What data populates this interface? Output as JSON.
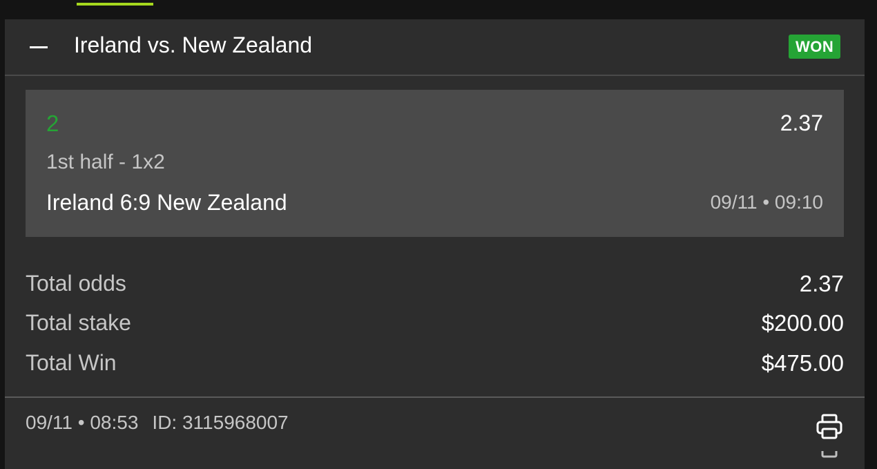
{
  "header": {
    "match_title": "Ireland vs. New Zealand",
    "status": "WON",
    "collapse_icon": "minus-icon"
  },
  "selection": {
    "pick": "2",
    "odds": "2.37",
    "market": "1st half - 1x2",
    "result": "Ireland 6:9 New Zealand",
    "datetime": "09/11 • 09:10"
  },
  "summary": {
    "total_odds_label": "Total odds",
    "total_odds_value": "2.37",
    "total_stake_label": "Total stake",
    "total_stake_value": "$200.00",
    "total_win_label": "Total Win",
    "total_win_value": "$475.00"
  },
  "footer": {
    "placed_datetime": "09/11 • 08:53",
    "bet_id": "ID: 3115968007",
    "print_icon": "printer-icon"
  },
  "colors": {
    "accent": "#a6d81e",
    "won": "#25a435",
    "card_bg": "#2d2d2d",
    "selection_bg": "#4a4a4a",
    "page_bg": "#141414"
  }
}
